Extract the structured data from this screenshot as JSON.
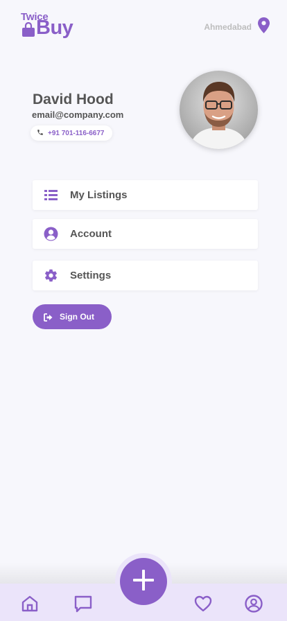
{
  "brand": {
    "line1": "Twice",
    "line2": "Buy",
    "color": "#8a5fc8"
  },
  "header": {
    "location": "Ahmedabad",
    "location_icon": "map-pin-icon"
  },
  "profile": {
    "name": "David Hood",
    "email": "email@company.com",
    "phone": "+91 701-116-6677",
    "phone_icon": "phone-icon",
    "avatar_icon": "avatar"
  },
  "menu": [
    {
      "label": "My Listings",
      "icon": "list-icon"
    },
    {
      "label": "Account",
      "icon": "user-circle-icon"
    },
    {
      "label": "Settings",
      "icon": "gear-icon"
    }
  ],
  "signout": {
    "label": "Sign Out",
    "icon": "sign-out-icon"
  },
  "bottom_nav": {
    "items": [
      "home-icon",
      "chat-icon",
      "add-icon",
      "heart-icon",
      "profile-icon"
    ],
    "background": "#ebe4fa",
    "accent": "#8a5fc8"
  }
}
